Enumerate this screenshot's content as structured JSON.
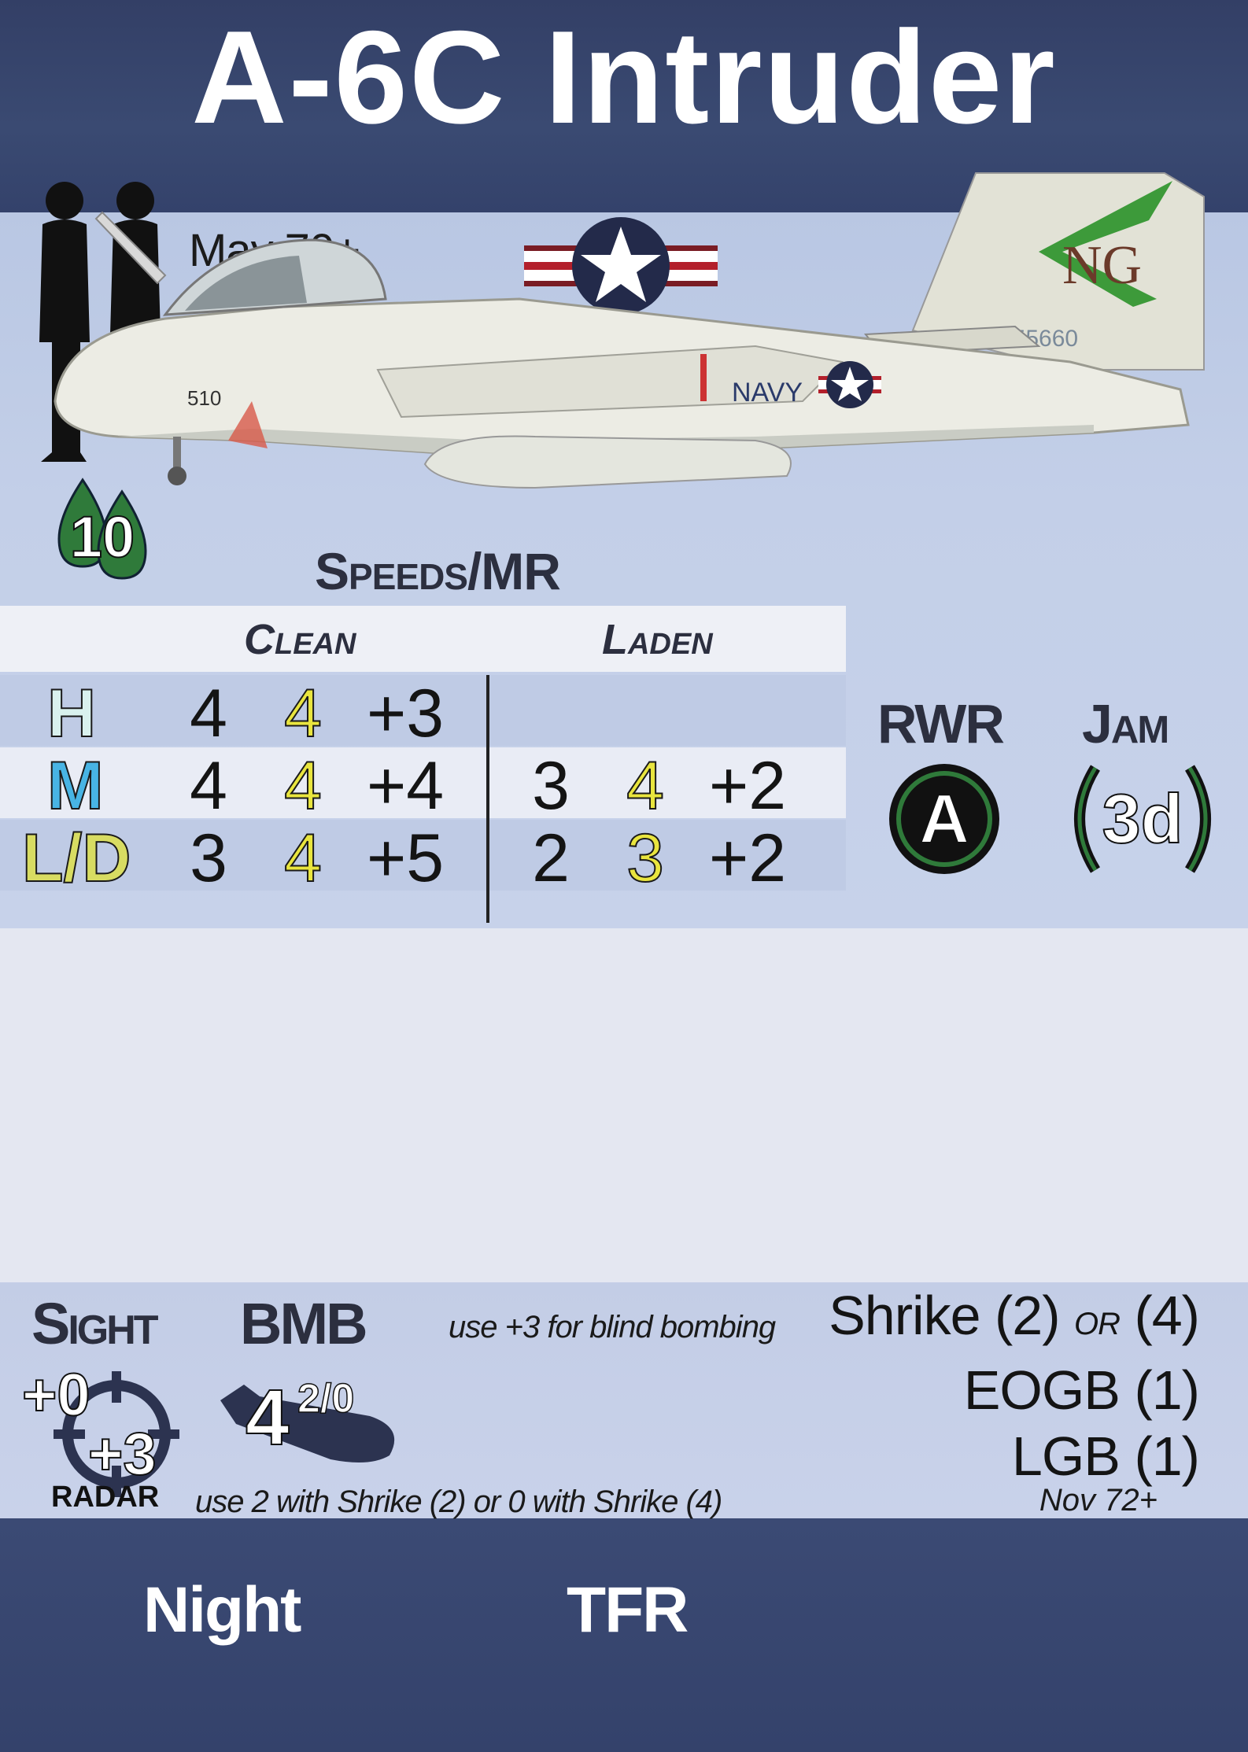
{
  "card": {
    "title": "A-6C Intruder",
    "availability": "May 70+",
    "fuel": "10",
    "nation_insignia": "us-navy-roundel",
    "aircraft_markings": [
      "NAVY",
      "NG",
      "155660",
      "510"
    ]
  },
  "speeds": {
    "title": "Speeds/MR",
    "clean_label": "Clean",
    "laden_label": "Laden",
    "rows": [
      {
        "alt": "H",
        "clean": [
          "4",
          "4",
          "+3"
        ],
        "laden": [
          "",
          "",
          ""
        ]
      },
      {
        "alt": "M",
        "clean": [
          "4",
          "4",
          "+4"
        ],
        "laden": [
          "3",
          "4",
          "+2"
        ]
      },
      {
        "alt": "L/D",
        "clean": [
          "3",
          "4",
          "+5"
        ],
        "laden": [
          "2",
          "3",
          "+2"
        ]
      }
    ]
  },
  "rwr": {
    "label": "RWR",
    "value": "A"
  },
  "jam": {
    "label": "Jam",
    "value": "3d"
  },
  "sight": {
    "label": "Sight",
    "value": "+0",
    "radar_value": "+3",
    "radar_label": "RADAR"
  },
  "bmb": {
    "label": "BMB",
    "value": "4",
    "sup": "2/0",
    "note": "use +3 for blind bombing",
    "shrike_note": "use 2 with Shrike (2) or 0 with Shrike (4)"
  },
  "weapons": [
    {
      "name": "Shrike",
      "count": "(2)",
      "or": "OR",
      "alt_count": "(4)"
    },
    {
      "name": "EOGB",
      "count": "(1)"
    },
    {
      "name": "LGB",
      "count": "(1)"
    }
  ],
  "weapons_date": "Nov 72+",
  "traits": [
    "Night",
    "TFR"
  ],
  "colors": {
    "band": "#34426b",
    "panel": "#c3cfe8",
    "alt_h": "#d9f1ee",
    "alt_m": "#48b4e4",
    "alt_ld": "#d8dc62",
    "maneuver": "#e9e53e",
    "fuel": "#2f7a3a"
  }
}
